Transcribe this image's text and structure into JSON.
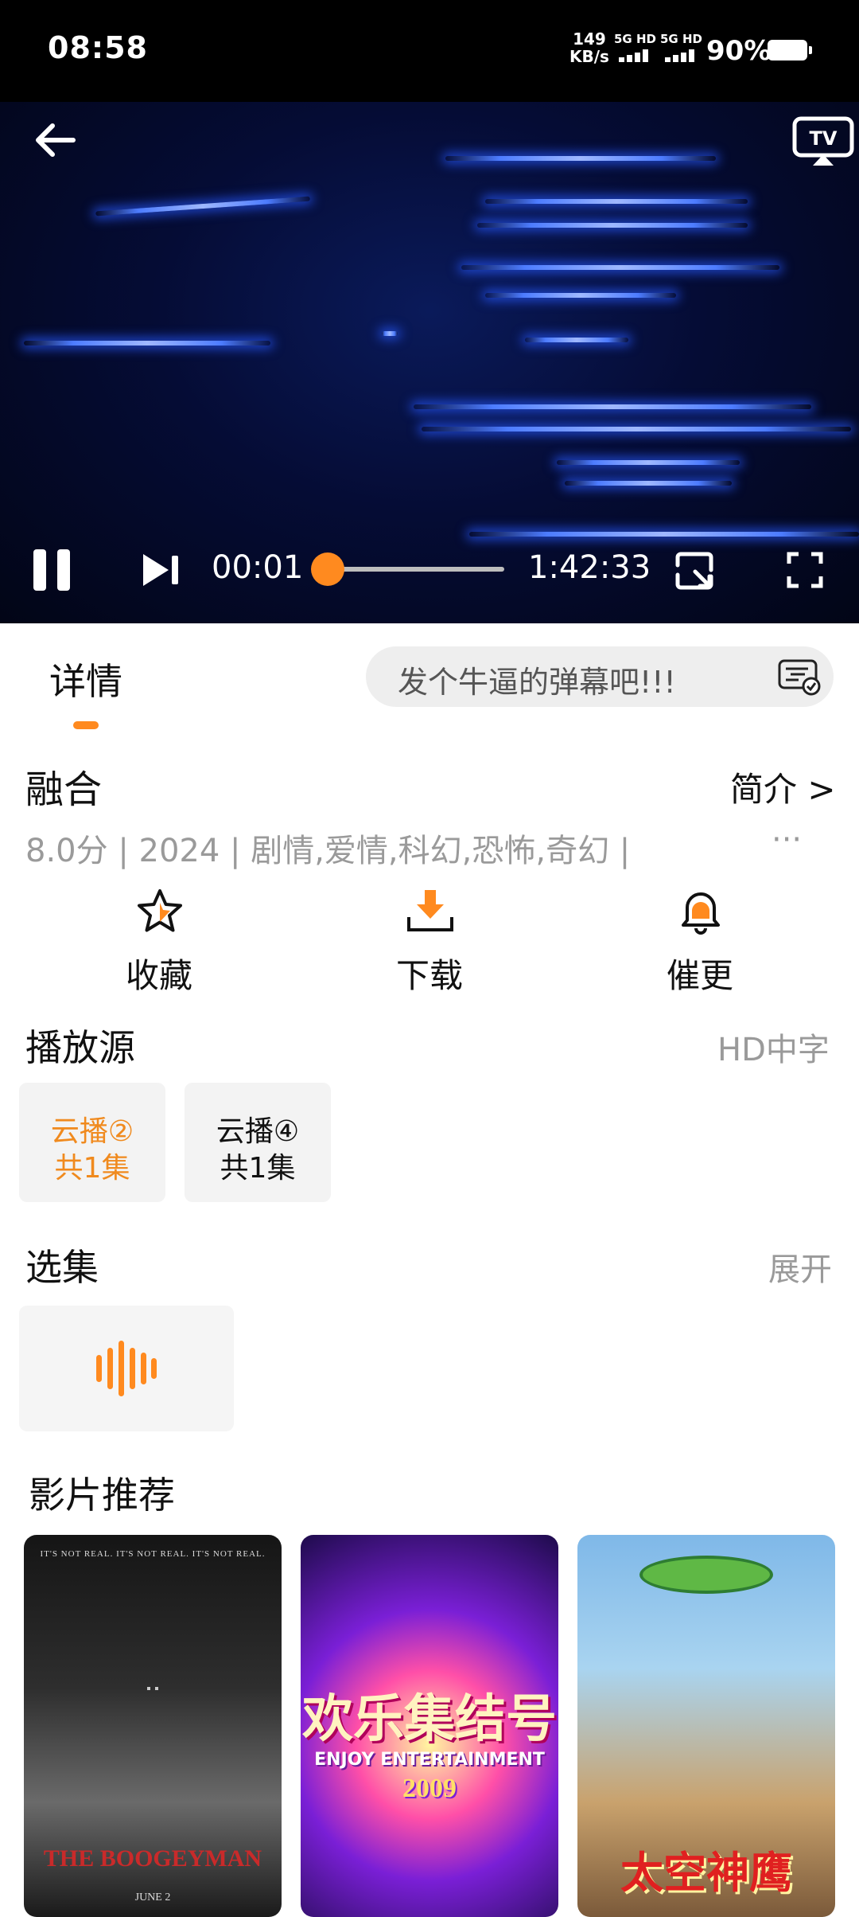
{
  "status_bar": {
    "time": "08:58",
    "net_speed_value": "149",
    "net_speed_unit": "KB/s",
    "sim1_label": "5G HD",
    "sim2_label": "5G HD",
    "battery_percent": "90%"
  },
  "player": {
    "current_time": "00:01",
    "total_time": "1:42:33",
    "progress": 0.0,
    "icons": [
      "back-arrow-icon",
      "tv-cast-icon",
      "pause-icon",
      "next-icon",
      "rotate-icon",
      "fullscreen-icon"
    ]
  },
  "tabs": {
    "detail": "详情",
    "danmaku_placeholder": "发个牛逼的弹幕吧!!!"
  },
  "movie": {
    "title": "融合",
    "intro_link": "简介 >",
    "meta": "8.0分   | 2024  |  剧情,爱情,科幻,恐怖,奇幻  |",
    "more": "···"
  },
  "actions": {
    "favorite": "收藏",
    "download": "下载",
    "remind": "催更"
  },
  "sources": {
    "title": "播放源",
    "quality": "HD中字",
    "items": [
      {
        "name": "云播②",
        "count": "共1集"
      },
      {
        "name": "云播④",
        "count": "共1集"
      }
    ]
  },
  "episodes": {
    "title": "选集",
    "expand": "展开"
  },
  "recommend": {
    "title": "影片推荐",
    "posters": [
      {
        "top_text": "IT'S NOT REAL. IT'S NOT REAL. IT'S NOT REAL.",
        "title": "THE BOOGEYMAN",
        "date": "JUNE 2"
      },
      {
        "title": "欢乐集结号",
        "subtitle": "ENJOY ENTERTAINMENT",
        "year": "2009"
      },
      {
        "title": "太空神鹰"
      }
    ]
  },
  "colors": {
    "accent": "#ff8a1f",
    "muted_text": "#9a9a9a",
    "video_bg": "#050c35"
  }
}
